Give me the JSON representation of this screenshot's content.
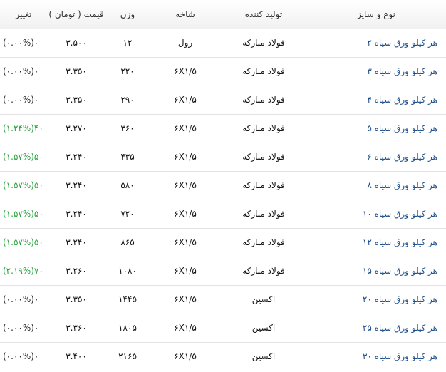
{
  "table": {
    "headers": {
      "product": "نوع و سایز",
      "producer": "تولید کننده",
      "branch": "شاخه",
      "weight": "وزن",
      "price": "قیمت ( تومان )",
      "change": "تغییر"
    },
    "rows": [
      {
        "product": "هر کیلو ورق سیاه ۲",
        "producer": "فولاد مبارکه",
        "branch": "رول",
        "weight": "۱۲",
        "price": "۳.۵۰۰",
        "change": "(۰.۰۰%)۰",
        "trend": "flat"
      },
      {
        "product": "هر کیلو ورق سیاه ۳",
        "producer": "فولاد مبارکه",
        "branch": "۶X۱/۵",
        "weight": "۲۲۰",
        "price": "۳.۳۵۰",
        "change": "(۰.۰۰%)۰",
        "trend": "flat"
      },
      {
        "product": "هر کیلو ورق سیاه ۴",
        "producer": "فولاد مبارکه",
        "branch": "۶X۱/۵",
        "weight": "۲۹۰",
        "price": "۳.۳۵۰",
        "change": "(۰.۰۰%)۰",
        "trend": "flat"
      },
      {
        "product": "هر کیلو ورق سیاه ۵",
        "producer": "فولاد مبارکه",
        "branch": "۶X۱/۵",
        "weight": "۳۶۰",
        "price": "۳.۲۷۰",
        "change": "(۱.۲۴%)۴۰",
        "trend": "up"
      },
      {
        "product": "هر کیلو ورق سیاه ۶",
        "producer": "فولاد مبارکه",
        "branch": "۶X۱/۵",
        "weight": "۴۳۵",
        "price": "۳.۲۴۰",
        "change": "(۱.۵۷%)۵۰",
        "trend": "up"
      },
      {
        "product": "هر کیلو ورق سیاه ۸",
        "producer": "فولاد مبارکه",
        "branch": "۶X۱/۵",
        "weight": "۵۸۰",
        "price": "۳.۲۴۰",
        "change": "(۱.۵۷%)۵۰",
        "trend": "up"
      },
      {
        "product": "هر کیلو ورق سیاه ۱۰",
        "producer": "فولاد مبارکه",
        "branch": "۶X۱/۵",
        "weight": "۷۲۰",
        "price": "۳.۲۴۰",
        "change": "(۱.۵۷%)۵۰",
        "trend": "up"
      },
      {
        "product": "هر کیلو ورق سیاه ۱۲",
        "producer": "فولاد مبارکه",
        "branch": "۶X۱/۵",
        "weight": "۸۶۵",
        "price": "۳.۲۴۰",
        "change": "(۱.۵۷%)۵۰",
        "trend": "up"
      },
      {
        "product": "هر کیلو ورق سیاه ۱۵",
        "producer": "فولاد مبارکه",
        "branch": "۶X۱/۵",
        "weight": "۱۰۸۰",
        "price": "۳.۲۶۰",
        "change": "(۲.۱۹%)۷۰",
        "trend": "up"
      },
      {
        "product": "هر کیلو ورق سیاه ۲۰",
        "producer": "اکسین",
        "branch": "۶X۱/۵",
        "weight": "۱۴۴۵",
        "price": "۳.۳۵۰",
        "change": "(۰.۰۰%)۰",
        "trend": "flat"
      },
      {
        "product": "هر کیلو ورق سیاه ۲۵",
        "producer": "اکسین",
        "branch": "۶X۱/۵",
        "weight": "۱۸۰۵",
        "price": "۳.۳۶۰",
        "change": "(۰.۰۰%)۰",
        "trend": "flat"
      },
      {
        "product": "هر کیلو ورق سیاه ۳۰",
        "producer": "اکسین",
        "branch": "۶X۱/۵",
        "weight": "۲۱۶۵",
        "price": "۳.۴۰۰",
        "change": "(۰.۰۰%)۰",
        "trend": "flat"
      }
    ]
  },
  "colors": {
    "link": "#1f4f8a",
    "up": "#27a33c",
    "flat": "#222222"
  }
}
